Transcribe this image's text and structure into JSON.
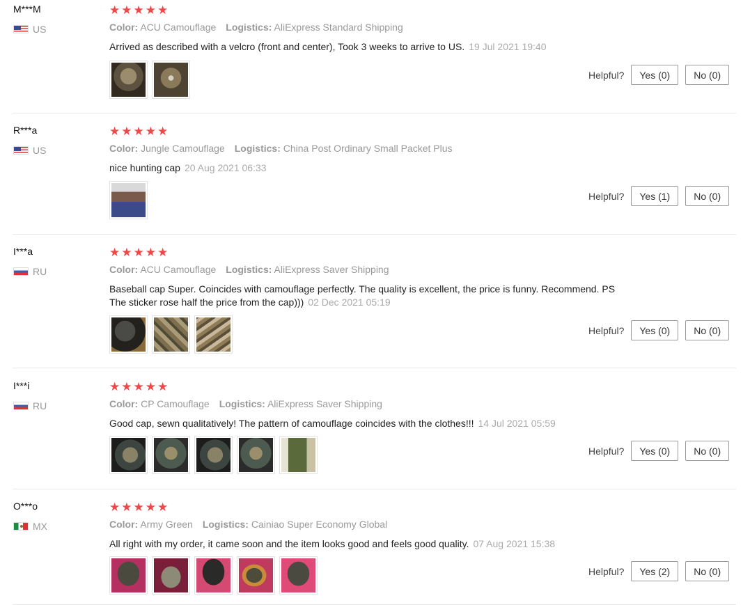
{
  "labels": {
    "color": "Color:",
    "logistics": "Logistics:",
    "helpful": "Helpful?"
  },
  "star_color": "#f04848",
  "reviews": [
    {
      "user": "M***M",
      "country": "US",
      "flag": "us-flag-icon",
      "rating": 5,
      "color": "ACU Camouflage",
      "logistics": "AliExpress Standard Shipping",
      "comment": "Arrived as described with a velcro (front and center), Took 3 weeks to arrive to US.",
      "date": "19 Jul 2021 19:40",
      "yes": "Yes (0)",
      "no": "No (0)"
    },
    {
      "user": "R***a",
      "country": "US",
      "flag": "us-flag-icon",
      "rating": 5,
      "color": "Jungle Camouflage",
      "logistics": "China Post Ordinary Small Packet Plus",
      "comment": "nice hunting cap",
      "date": "20 Aug 2021 06:33",
      "yes": "Yes (1)",
      "no": "No (0)"
    },
    {
      "user": "I***a",
      "country": "RU",
      "flag": "ru-flag-icon",
      "rating": 5,
      "color": "ACU Camouflage",
      "logistics": "AliExpress Saver Shipping",
      "comment_line1": "Baseball cap Super. Coincides with camouflage perfectly. The quality is excellent, the price is funny. Recommend. PS",
      "comment_line2": "The sticker rose half the price from the cap)))",
      "date": "02 Dec 2021 05:19",
      "yes": "Yes (0)",
      "no": "No (0)"
    },
    {
      "user": "I***i",
      "country": "RU",
      "flag": "ru-flag-icon",
      "rating": 5,
      "color": "CP Camouflage",
      "logistics": "AliExpress Saver Shipping",
      "comment": "Good cap, sewn qualitatively! The pattern of camouflage coincides with the clothes!!!",
      "date": "14 Jul 2021 05:59",
      "yes": "Yes (0)",
      "no": "No (0)"
    },
    {
      "user": "O***o",
      "country": "MX",
      "flag": "mx-flag-icon",
      "rating": 5,
      "color": "Army Green",
      "logistics": "Cainiao Super Economy Global",
      "comment": "All right with my order, it came soon and the item looks good and feels good quality.",
      "date": "07 Aug 2021 15:38",
      "yes": "Yes (2)",
      "no": "No (0)"
    }
  ]
}
